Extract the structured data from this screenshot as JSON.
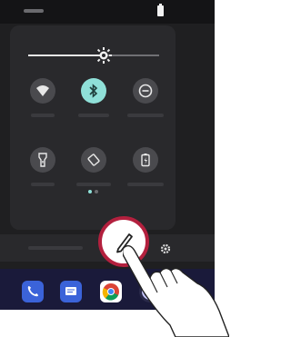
{
  "screen": {
    "colors": {
      "background": "#1f1f21",
      "panel": "#29292c",
      "tile_off": "#4a4a4e",
      "tile_on": "#8fe0d8",
      "highlight": "#b3203e",
      "dock": "#1a1a3a"
    }
  },
  "status_bar": {
    "battery_icon": "battery-icon"
  },
  "brightness": {
    "level": 0.58,
    "icon": "brightness-icon"
  },
  "quick_settings": {
    "tiles": [
      {
        "icon": "wifi-icon",
        "active": false
      },
      {
        "icon": "bluetooth-icon",
        "active": true
      },
      {
        "icon": "do-not-disturb-icon",
        "active": false
      },
      {
        "icon": "flashlight-icon",
        "active": false
      },
      {
        "icon": "auto-rotate-icon",
        "active": false
      },
      {
        "icon": "battery-saver-icon",
        "active": false
      }
    ],
    "page_indicator": {
      "pages": 2,
      "current": 1
    }
  },
  "bottom_bar": {
    "edit_icon": "pencil-icon",
    "settings_icon": "gear-icon"
  },
  "dock": {
    "apps": [
      {
        "icon": "phone-icon",
        "color": "#3b63d9"
      },
      {
        "icon": "messages-icon",
        "color": "#3b63d9"
      },
      {
        "icon": "chrome-icon",
        "color": "#ffffff"
      },
      {
        "icon": "camera-icon",
        "color": "#2a2a4a"
      }
    ]
  },
  "gesture": {
    "icon": "hand-pointer-icon"
  }
}
